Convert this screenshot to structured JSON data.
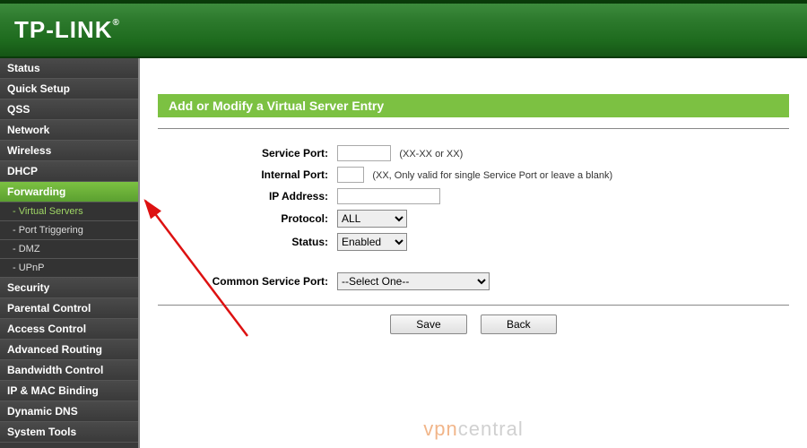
{
  "brand": "TP-LINK",
  "sidebar": {
    "items": [
      {
        "label": "Status"
      },
      {
        "label": "Quick Setup"
      },
      {
        "label": "QSS"
      },
      {
        "label": "Network"
      },
      {
        "label": "Wireless"
      },
      {
        "label": "DHCP"
      },
      {
        "label": "Forwarding",
        "active": true
      },
      {
        "label": "Security"
      },
      {
        "label": "Parental Control"
      },
      {
        "label": "Access Control"
      },
      {
        "label": "Advanced Routing"
      },
      {
        "label": "Bandwidth Control"
      },
      {
        "label": "IP & MAC Binding"
      },
      {
        "label": "Dynamic DNS"
      },
      {
        "label": "System Tools"
      }
    ],
    "subs": [
      {
        "label": "- Virtual Servers",
        "active": true
      },
      {
        "label": "- Port Triggering"
      },
      {
        "label": "- DMZ"
      },
      {
        "label": "- UPnP"
      }
    ]
  },
  "page": {
    "title": "Add or Modify a Virtual Server Entry",
    "fields": {
      "service_port": {
        "label": "Service Port:",
        "value": "",
        "hint": "(XX-XX or XX)"
      },
      "internal_port": {
        "label": "Internal Port:",
        "value": "",
        "hint": "(XX, Only valid for single Service Port or leave a blank)"
      },
      "ip_address": {
        "label": "IP Address:",
        "value": ""
      },
      "protocol": {
        "label": "Protocol:",
        "value": "ALL"
      },
      "status": {
        "label": "Status:",
        "value": "Enabled"
      },
      "common_service_port": {
        "label": "Common Service Port:",
        "value": "--Select One--"
      }
    },
    "buttons": {
      "save": "Save",
      "back": "Back"
    }
  },
  "watermark": {
    "prefix": "vpn",
    "suffix": "central"
  }
}
